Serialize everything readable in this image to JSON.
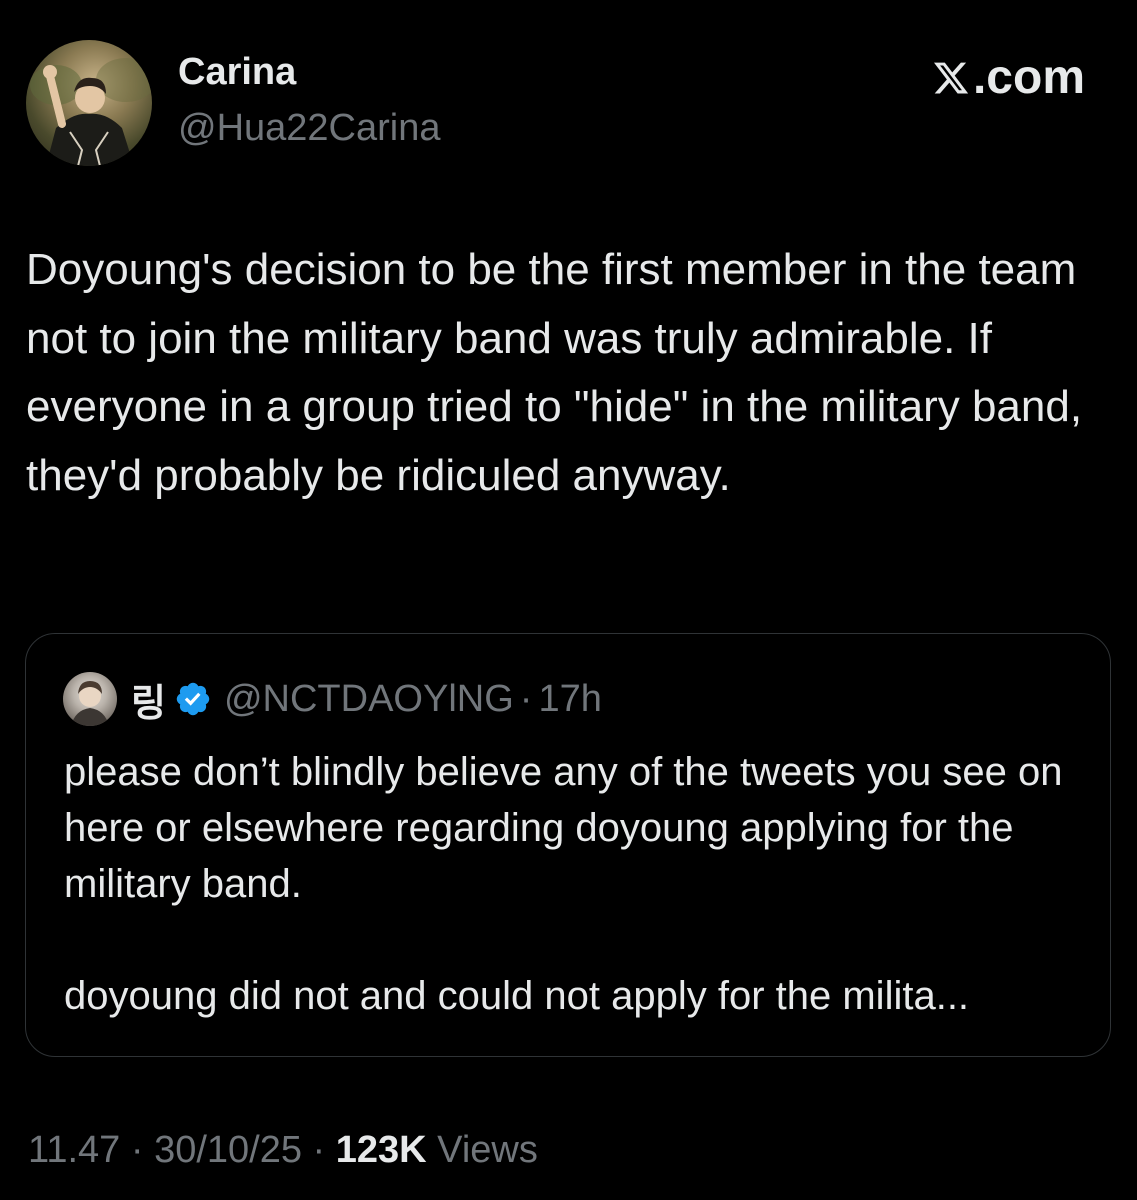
{
  "author": {
    "display_name": "Carina",
    "handle": "@Hua22Carina"
  },
  "site_label": ".com",
  "tweet": {
    "text": "Doyoung's decision to be the first member in the team not to join the military band was truly admirable. If everyone in a group tried to \"hide\" in the military band, they'd probably be ridiculed anyway."
  },
  "quoted_tweet": {
    "display_name": "링",
    "verified": true,
    "handle": "@NCTDAOYlNG",
    "separator": "·",
    "time": "17h",
    "text": "please don’t blindly believe any of the tweets you see on here or elsewhere regarding doyoung applying for the military band.\n\ndoyoung did not and could not apply for the milita..."
  },
  "meta": {
    "time": "11.47",
    "separator": " · ",
    "date": "30/10/25",
    "views_count": "123K",
    "views_label": "Views"
  },
  "colors": {
    "background": "#000000",
    "primary_text": "#e7e9ea",
    "secondary_text": "#71767b",
    "border": "#2f3336",
    "verified_badge": "#1d9bf0"
  },
  "icons": {
    "site_logo": "x-logo-icon",
    "verified": "verified-badge-icon"
  }
}
